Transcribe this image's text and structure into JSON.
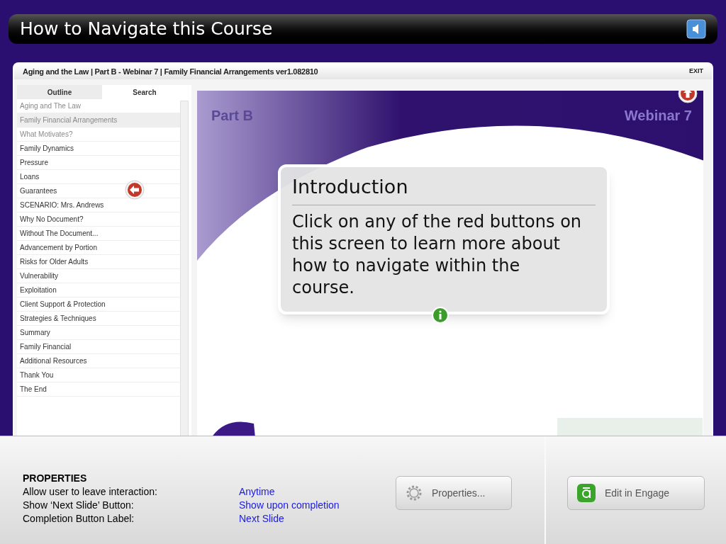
{
  "header": {
    "title": "How to Navigate this Course"
  },
  "course": {
    "title": "Aging and the Law | Part B - Webinar 7 | Family Financial Arrangements ver1.082810",
    "exit": "EXIT",
    "tabs": [
      {
        "label": "Outline",
        "selected": true
      },
      {
        "label": "Search",
        "selected": false
      }
    ],
    "outline": [
      {
        "label": "Aging and The Law",
        "selected": false,
        "visited": true
      },
      {
        "label": "Family Financial Arrangements",
        "selected": true,
        "visited": true
      },
      {
        "label": "What Motivates?",
        "selected": false,
        "visited": true
      },
      {
        "label": "Family Dynamics",
        "selected": false,
        "visited": false
      },
      {
        "label": "Pressure",
        "selected": false,
        "visited": false
      },
      {
        "label": "Loans",
        "selected": false,
        "visited": false
      },
      {
        "label": "Guarantees",
        "selected": false,
        "visited": false
      },
      {
        "label": "SCENARIO: Mrs. Andrews",
        "selected": false,
        "visited": false
      },
      {
        "label": "Why No Document?",
        "selected": false,
        "visited": false
      },
      {
        "label": "Without The Document...",
        "selected": false,
        "visited": false
      },
      {
        "label": "Advancement by Portion",
        "selected": false,
        "visited": false
      },
      {
        "label": "Risks for Older Adults",
        "selected": false,
        "visited": false
      },
      {
        "label": "Vulnerability",
        "selected": false,
        "visited": false
      },
      {
        "label": "Exploitation",
        "selected": false,
        "visited": false
      },
      {
        "label": "Client Support & Protection",
        "selected": false,
        "visited": false
      },
      {
        "label": "Strategies & Techniques",
        "selected": false,
        "visited": false
      },
      {
        "label": "Summary",
        "selected": false,
        "visited": false
      },
      {
        "label": "Family Financial",
        "selected": false,
        "visited": false
      },
      {
        "label": "Additional Resources",
        "selected": false,
        "visited": false
      },
      {
        "label": "Thank You",
        "selected": false,
        "visited": false
      },
      {
        "label": "The End",
        "selected": false,
        "visited": false
      }
    ],
    "slide": {
      "corner_left": "Part B",
      "corner_right": "Webinar 7"
    },
    "popup": {
      "title": "Introduction",
      "body": "Click on any of the red buttons on this screen to learn more about how to navigate within the course."
    }
  },
  "properties": {
    "heading": "PROPERTIES",
    "rows": [
      {
        "label": "Allow user to leave interaction:",
        "value": "Anytime"
      },
      {
        "label": "Show ‘Next Slide’ Button:",
        "value": "Show upon completion"
      },
      {
        "label": "Completion Button Label:",
        "value": "Next Slide"
      }
    ],
    "buttons": [
      {
        "kind": "gear",
        "label": "Properties..."
      },
      {
        "kind": "engage",
        "label": "Edit in Engage"
      }
    ]
  }
}
